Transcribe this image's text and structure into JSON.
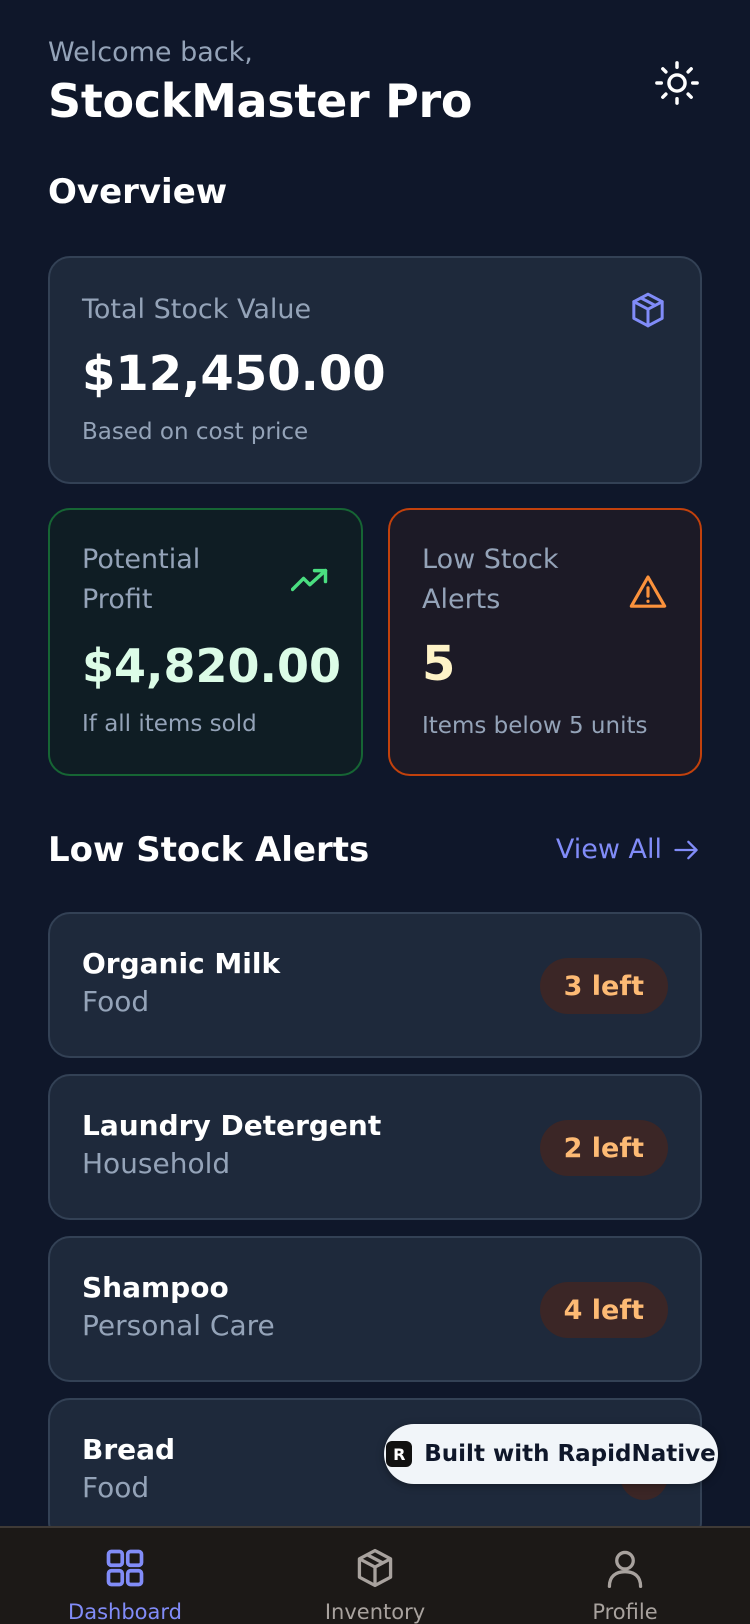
{
  "header": {
    "welcome": "Welcome back,",
    "title": "StockMaster Pro",
    "theme_icon": "sun-icon"
  },
  "overview": {
    "title": "Overview",
    "total_stock": {
      "label": "Total Stock Value",
      "value": "$12,450.00",
      "sub": "Based on cost price",
      "icon": "box-icon"
    },
    "profit": {
      "label": "Potential Profit",
      "value": "$4,820.00",
      "sub": "If all items sold",
      "icon": "trending-up-icon"
    },
    "alerts": {
      "label": "Low Stock Alerts",
      "value": "5",
      "sub": "Items below 5 units",
      "icon": "warning-icon"
    }
  },
  "low_stock": {
    "title": "Low Stock Alerts",
    "view_all": "View All",
    "items": [
      {
        "name": "Organic Milk",
        "category": "Food",
        "badge": "3 left"
      },
      {
        "name": "Laundry Detergent",
        "category": "Household",
        "badge": "2 left"
      },
      {
        "name": "Shampoo",
        "category": "Personal Care",
        "badge": "4 left"
      },
      {
        "name": "Bread",
        "category": "Food",
        "badge": ""
      }
    ]
  },
  "branding": {
    "label": "Built with RapidNative"
  },
  "tabs": [
    {
      "label": "Dashboard",
      "icon": "grid-icon",
      "active": true
    },
    {
      "label": "Inventory",
      "icon": "box-icon",
      "active": false
    },
    {
      "label": "Profile",
      "icon": "user-icon",
      "active": false
    }
  ],
  "colors": {
    "background": "#0f172a",
    "accent": "#818cf8",
    "profit": "#4ade80",
    "warning": "#fb923c"
  }
}
